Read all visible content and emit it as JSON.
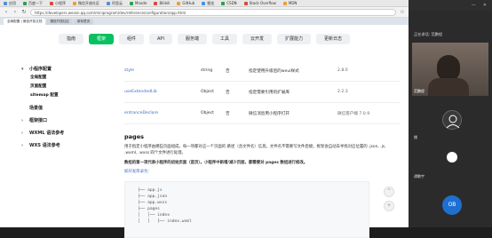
{
  "browser": {
    "bookmarks": [
      "应用",
      "百度一下",
      "小程序",
      "微信开放社区",
      "阿里云",
      "Mnode",
      "Bilibili",
      "GitHub",
      "掘金",
      "CSDN",
      "Stack Overflow",
      "MDN"
    ],
    "url": "https://developers.weixin.qq.com/miniprogram/dev/reference/configuration/app.html",
    "tabs": [
      "全局配置 | 微信开放文档",
      "微信开放社区",
      "新标签页"
    ]
  },
  "topnav": {
    "items": [
      "指南",
      "框架",
      "组件",
      "API",
      "服务端",
      "工具",
      "云开发",
      "扩展能力",
      "更新日志"
    ],
    "active_index": 1
  },
  "sidebar": {
    "items": [
      {
        "label": "小程序配置",
        "type": "section",
        "caret": "▾"
      },
      {
        "label": "全局配置",
        "type": "sub"
      },
      {
        "label": "页面配置",
        "type": "sub"
      },
      {
        "label": "sitemap 配置",
        "type": "sub"
      },
      {
        "label": "场景值",
        "type": "section",
        "caret": ""
      },
      {
        "label": "框架接口",
        "type": "section",
        "caret": "›"
      },
      {
        "label": "WXML 语法参考",
        "type": "section",
        "caret": "›"
      },
      {
        "label": "WXS 语法参考",
        "type": "section",
        "caret": "›"
      }
    ]
  },
  "table": {
    "rows": [
      {
        "prop": "style",
        "type": "string",
        "required": "否",
        "desc": "指定使用升级后的weui样式",
        "ver": "2.8.0"
      },
      {
        "prop": "useExtendedLib",
        "type": "Object",
        "required": "否",
        "desc": "指定需要引用的扩展库",
        "ver": "2.2.3"
      },
      {
        "prop": "entranceDeclare",
        "type": "Object",
        "required": "否",
        "desc": "微信消息用小程序打开",
        "ver": "微信客户端 7.0.9"
      }
    ]
  },
  "section": {
    "title": "pages",
    "p1": "用于指定小程序由哪些页面组成，每一项都对应一个页面的 路径（含文件名）信息。文件名不需要写文件后缀，框架会自动去寻找对应位置的 .json, .js, .wxml, .wxss 四个文件进行处理。",
    "p2": "数组的第一项代表小程序的初始页面（首页）。小程序中新增/减少页面，都需要对 pages 数组进行修改。",
    "link": "如开发目录为：",
    "code": "├── app.js\n├── app.json\n├── app.wxss\n├── pages\n│   │── index\n│   │   ├── index.wxml"
  },
  "conference": {
    "header_icons": [
      "最小化",
      "关闭"
    ],
    "title_line1": "正在讲话: 范鹏程",
    "title_line2": "",
    "video_name": "范鹏程",
    "participants": [
      {
        "name": "棚",
        "color": "#3a3a3a"
      },
      {
        "name": "谭鹏宇",
        "color": "#2c2c2c"
      },
      {
        "name": "OB",
        "color": "#1f6fd1"
      }
    ]
  },
  "colors": {
    "accent": "#07c160",
    "link": "#3b6ccf"
  }
}
